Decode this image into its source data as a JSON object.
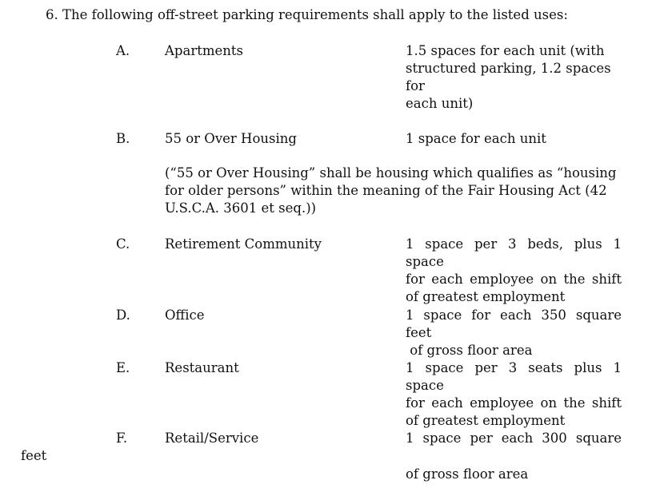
{
  "heading": "6. The following off-street parking requirements shall apply to the listed uses:",
  "items": [
    {
      "letter": "A.",
      "use": "Apartments",
      "requirement_lines": [
        "1.5 spaces for each unit (with",
        "structured parking, 1.2 spaces",
        "for",
        "each unit)"
      ]
    },
    {
      "letter": "B.",
      "use": "55 or Over Housing",
      "requirement_lines": [
        "1 space for each unit"
      ],
      "note_lines": [
        "(“55 or Over Housing” shall be housing which qualifies as “housing",
        "for older persons” within the meaning of the Fair Housing Act (42",
        "U.S.C.A. 3601 et seq.))"
      ]
    },
    {
      "letter": "C.",
      "use": "Retirement Community",
      "requirement_lines": [
        "1 space per 3 beds, plus 1 space",
        "for each employee on the shift",
        "of greatest employment"
      ]
    },
    {
      "letter": "D.",
      "use": "Office",
      "requirement_lines": [
        "1 space for each 350 square feet",
        " of gross floor area"
      ]
    },
    {
      "letter": "E.",
      "use": "Restaurant",
      "requirement_lines": [
        "1 space per 3 seats plus 1 space",
        "for each employee on the shift",
        "of greatest employment"
      ]
    },
    {
      "letter": "F.",
      "use": "Retail/Service",
      "requirement_lines": [
        "1 space per each 300 square"
      ],
      "requirement_continued": "of gross floor area"
    }
  ],
  "stray_text": "feet"
}
